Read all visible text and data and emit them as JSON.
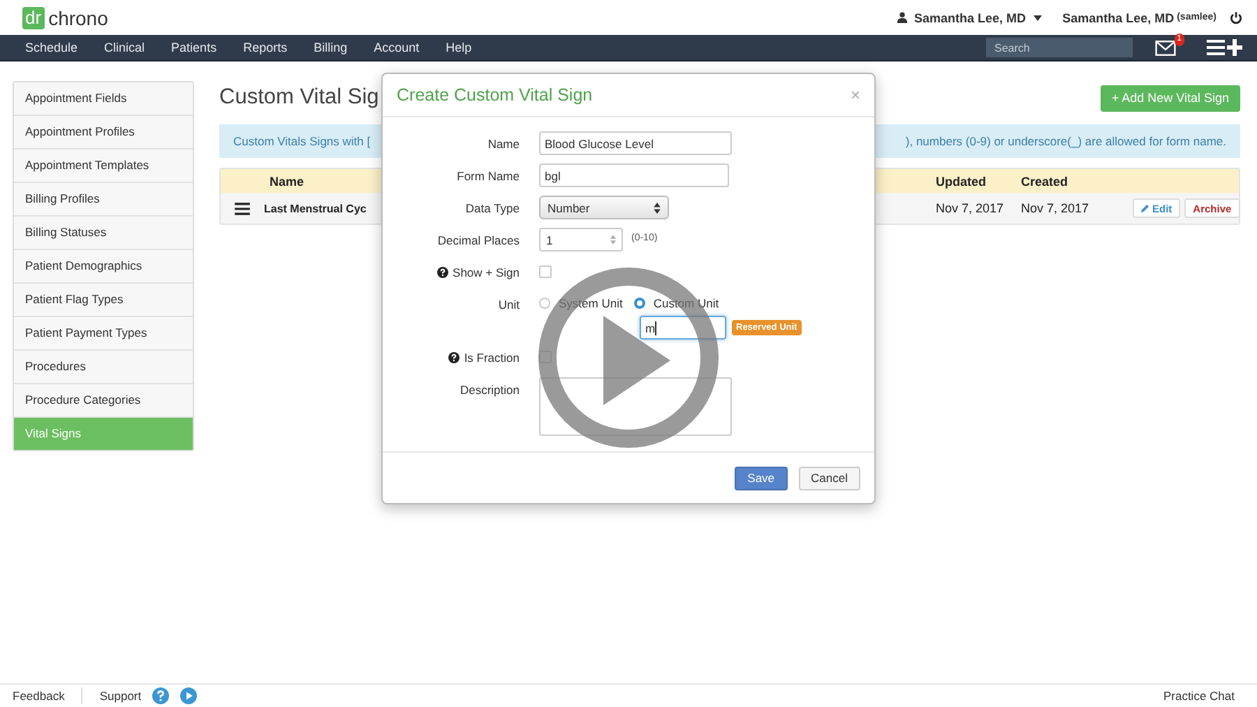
{
  "header": {
    "logo_mark": "dr",
    "logo_text": "chrono",
    "user_menu": "Samantha Lee, MD",
    "account_name": "Samantha Lee, MD",
    "account_handle": "(samlee)"
  },
  "nav": {
    "items": [
      "Schedule",
      "Clinical",
      "Patients",
      "Reports",
      "Billing",
      "Account",
      "Help"
    ],
    "search": {
      "placeholder": "Search"
    },
    "mail_badge": "1"
  },
  "sidebar": {
    "items": [
      {
        "label": "Appointment Fields",
        "selected": false
      },
      {
        "label": "Appointment Profiles",
        "selected": false
      },
      {
        "label": "Appointment Templates",
        "selected": false
      },
      {
        "label": "Billing Profiles",
        "selected": false
      },
      {
        "label": "Billing Statuses",
        "selected": false
      },
      {
        "label": "Patient Demographics",
        "selected": false
      },
      {
        "label": "Patient Flag Types",
        "selected": false
      },
      {
        "label": "Patient Payment Types",
        "selected": false
      },
      {
        "label": "Procedures",
        "selected": false
      },
      {
        "label": "Procedure Categories",
        "selected": false
      },
      {
        "label": "Vital Signs",
        "selected": true
      }
    ]
  },
  "page": {
    "title": "Custom Vital Sig",
    "add_button": "+ Add New Vital Sign",
    "info_left": "Custom Vitals Signs with [",
    "info_right": "), numbers (0-9) or underscore(_) are allowed for form name.",
    "table": {
      "columns": [
        "Name",
        "Updated",
        "Created"
      ],
      "rows": [
        {
          "name": "Last Menstrual Cyc",
          "updated": "Nov 7, 2017",
          "created": "Nov 7, 2017",
          "edit": "Edit",
          "archive": "Archive"
        }
      ]
    }
  },
  "modal": {
    "title": "Create Custom Vital Sign",
    "close": "×",
    "fields": [
      {
        "kind": "text",
        "label": "Name",
        "value": "Blood Glucose Level",
        "help": false
      },
      {
        "kind": "text",
        "label": "Form Name",
        "value": "bgl",
        "help": false
      },
      {
        "kind": "select",
        "label": "Data Type",
        "value": "Number",
        "help": false
      },
      {
        "kind": "number",
        "label": "Decimal Places",
        "value": "1",
        "hint": "(0-10)",
        "help": false
      },
      {
        "kind": "checkbox",
        "label": "Show + Sign",
        "checked": false,
        "help": true
      },
      {
        "kind": "radio",
        "label": "Unit",
        "options": [
          {
            "label": "System Unit",
            "selected": false
          },
          {
            "label": "Custom Unit",
            "selected": true
          }
        ],
        "value": "m",
        "badge": "Reserved Unit",
        "help": false
      },
      {
        "kind": "checkbox",
        "label": "Is Fraction",
        "checked": false,
        "help": true
      },
      {
        "kind": "textarea",
        "label": "Description",
        "help": false
      }
    ],
    "buttons": [
      {
        "label": "Save",
        "primary": true
      },
      {
        "label": "Cancel",
        "primary": false
      }
    ]
  },
  "footer": {
    "links": [
      "Feedback",
      "Support"
    ],
    "chat": "Practice Chat"
  }
}
